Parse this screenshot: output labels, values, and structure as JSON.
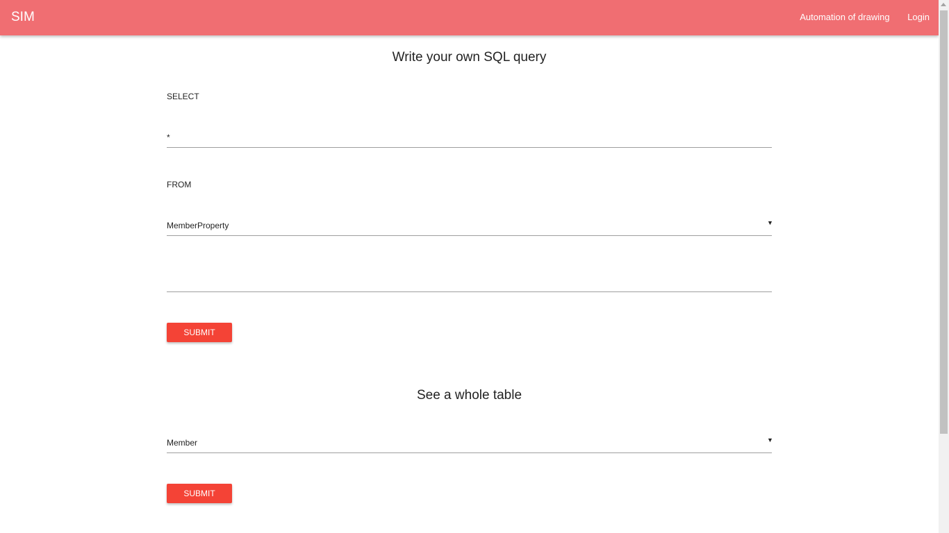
{
  "nav": {
    "brand": "SIM",
    "links": [
      "Automation of drawing",
      "Login"
    ]
  },
  "query": {
    "title": "Write your own SQL query",
    "select_label": "SELECT",
    "select_value": "*",
    "from_label": "FROM",
    "from_value": "MemberProperty",
    "extra_value": "",
    "submit": "SUBMIT"
  },
  "table": {
    "title": "See a whole table",
    "value": "Member",
    "submit": "SUBMIT"
  },
  "colors": {
    "navbar": "#f06e72",
    "button": "#f44336"
  }
}
